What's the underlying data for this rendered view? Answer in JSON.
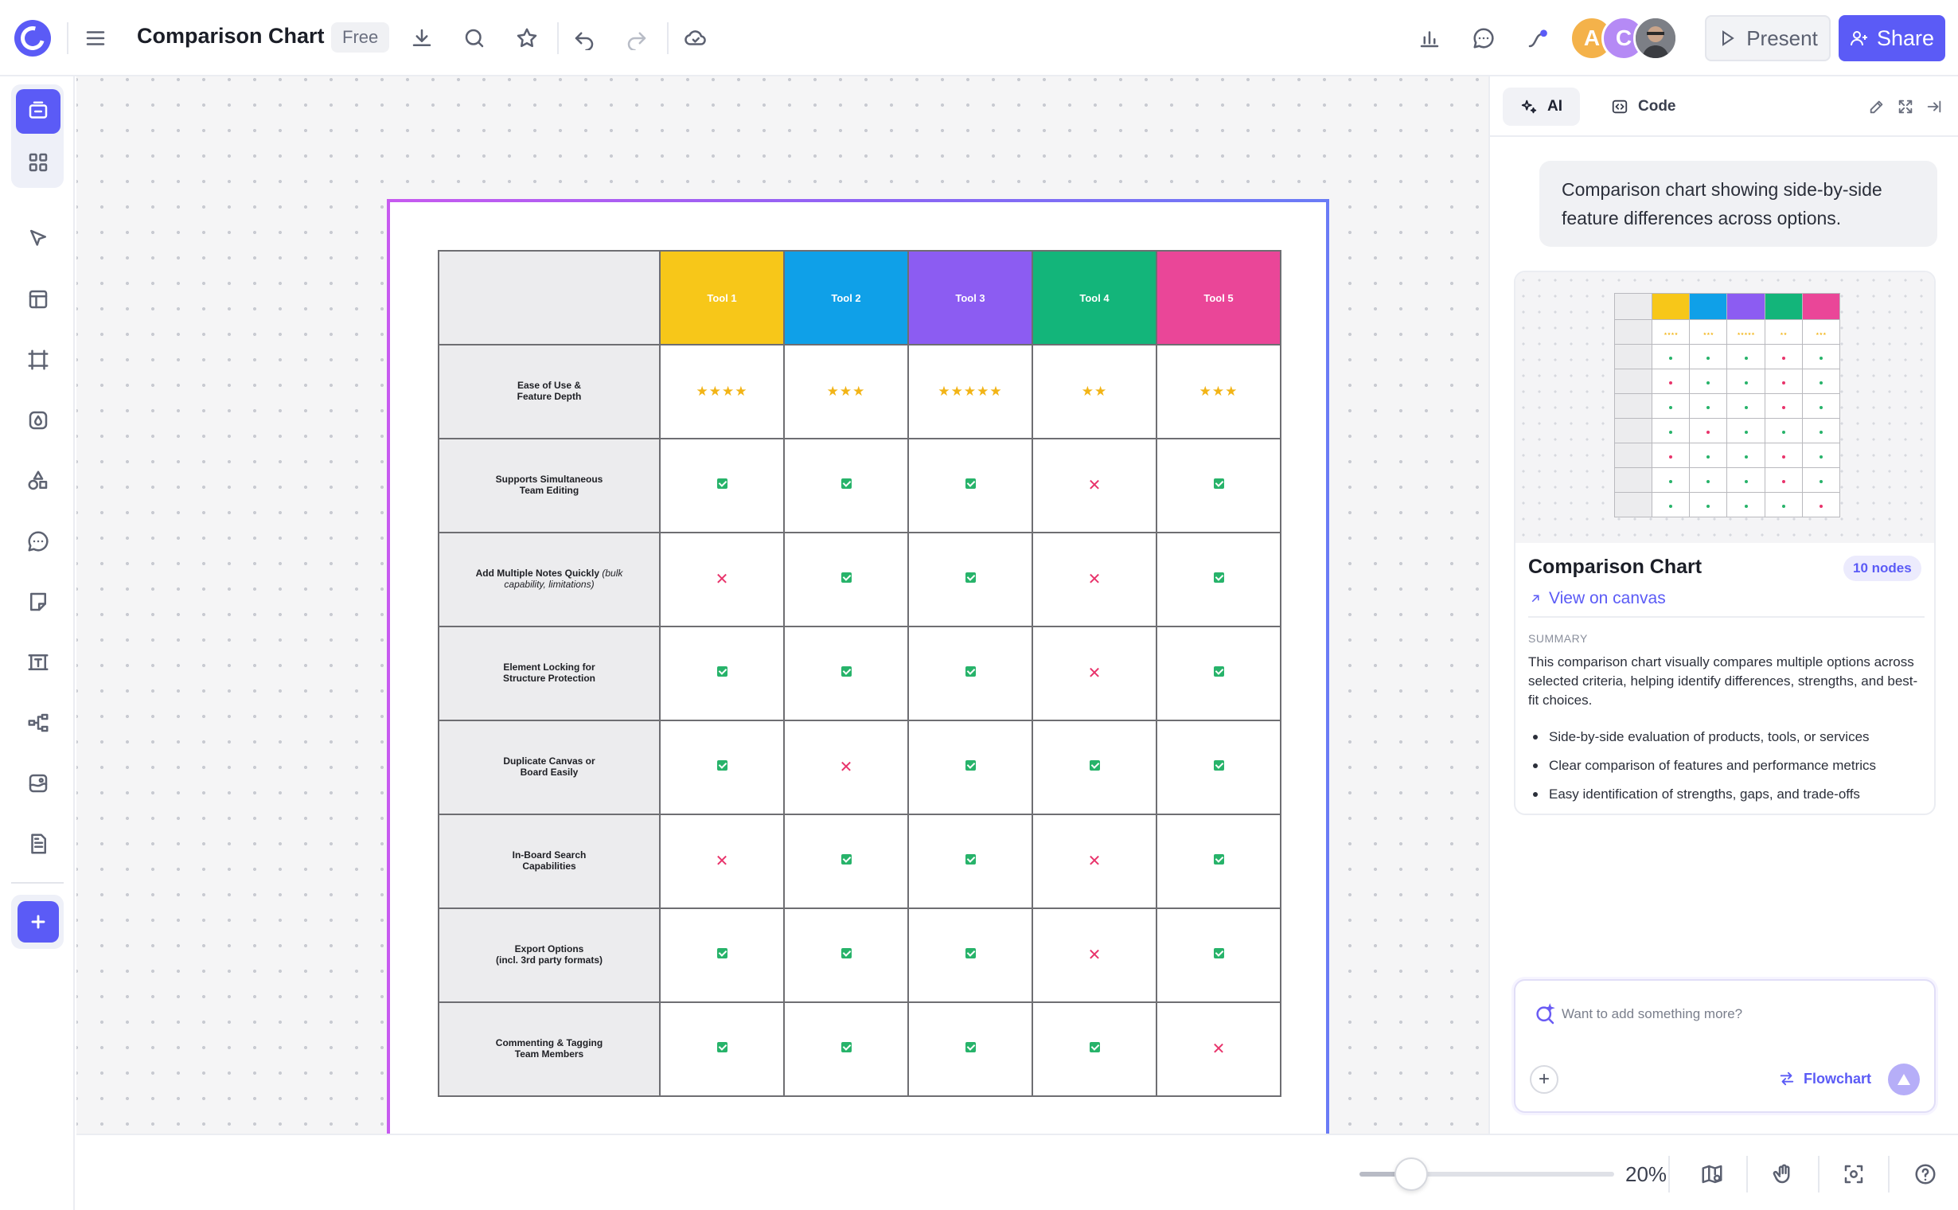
{
  "header": {
    "title": "Comparison Chart",
    "plan_badge": "Free",
    "present_label": "Present",
    "share_label": "Share",
    "avatars": [
      {
        "initial": "A",
        "color": "#f4b24a"
      },
      {
        "initial": "C",
        "color": "#b58af5"
      },
      {
        "initial": "",
        "color": "#6b6e75"
      }
    ],
    "icons": [
      "menu-icon",
      "download-icon",
      "search-icon",
      "star-icon",
      "undo-icon",
      "redo-icon",
      "cloud-icon",
      "chart-icon",
      "comment-icon",
      "connector-icon"
    ]
  },
  "toolbar": {
    "items": [
      "ai-canvas",
      "templates",
      "select",
      "layout",
      "frame",
      "color-mode",
      "shapes",
      "comments",
      "sticky-note",
      "text",
      "mindmap",
      "embed",
      "document",
      "add"
    ]
  },
  "chart_board": {
    "tools": [
      {
        "name": "Tool 1",
        "color": "#f7c719"
      },
      {
        "name": "Tool 2",
        "color": "#0fa0e8"
      },
      {
        "name": "Tool 3",
        "color": "#8c5cf2"
      },
      {
        "name": "Tool 4",
        "color": "#13b57a"
      },
      {
        "name": "Tool 5",
        "color": "#ea4698"
      }
    ],
    "rows": [
      {
        "label": "Ease of Use &",
        "label2": "Feature Depth",
        "note": "",
        "type": "stars",
        "values": [
          "★★★★",
          "★★★",
          "★★★★★",
          "★★",
          "★★★"
        ]
      },
      {
        "label": "Supports Simultaneous",
        "label2": "Team Editing",
        "note": "",
        "type": "check",
        "values": [
          true,
          true,
          true,
          false,
          true
        ]
      },
      {
        "label": "Add Multiple Notes Quickly",
        "label2": "limitations)",
        "note": "(bulk capability,",
        "type": "check",
        "values": [
          false,
          true,
          true,
          false,
          true
        ]
      },
      {
        "label": "Element Locking for",
        "label2": "Structure Protection",
        "note": "",
        "type": "check",
        "values": [
          true,
          true,
          true,
          false,
          true
        ]
      },
      {
        "label": "Duplicate Canvas or",
        "label2": "Board Easily",
        "note": "",
        "type": "check",
        "values": [
          true,
          false,
          true,
          true,
          true
        ]
      },
      {
        "label": "In-Board Search",
        "label2": "Capabilities",
        "note": "",
        "type": "check",
        "values": [
          false,
          true,
          true,
          false,
          true
        ]
      },
      {
        "label": "Export Options",
        "label2": "(incl. 3rd party formats)",
        "note": "",
        "type": "check",
        "values": [
          true,
          true,
          true,
          false,
          true
        ]
      },
      {
        "label": "Commenting & Tagging",
        "label2": "Team Members",
        "note": "",
        "type": "check",
        "values": [
          true,
          true,
          true,
          true,
          false
        ]
      }
    ]
  },
  "panel": {
    "tab_ai": "AI",
    "tab_code": "Code",
    "user_message": "Comparison chart showing side-by-side feature differences across options.",
    "card": {
      "title": "Comparison Chart",
      "nodes_badge": "10 nodes",
      "view_link": "View on canvas",
      "summary_label": "SUMMARY",
      "summary_text": "This comparison chart visually compares multiple options across selected criteria, helping identify differences, strengths, and best-fit choices.",
      "bullets": [
        "Side-by-side evaluation of products, tools, or services",
        "Clear comparison of features and performance metrics",
        "Easy identification of strengths, gaps, and trade-offs"
      ]
    },
    "composer": {
      "placeholder": "Want to add something more?",
      "mode_label": "Flowchart"
    }
  },
  "bottom": {
    "zoom_label": "20%",
    "zoom_value": 0.2
  }
}
